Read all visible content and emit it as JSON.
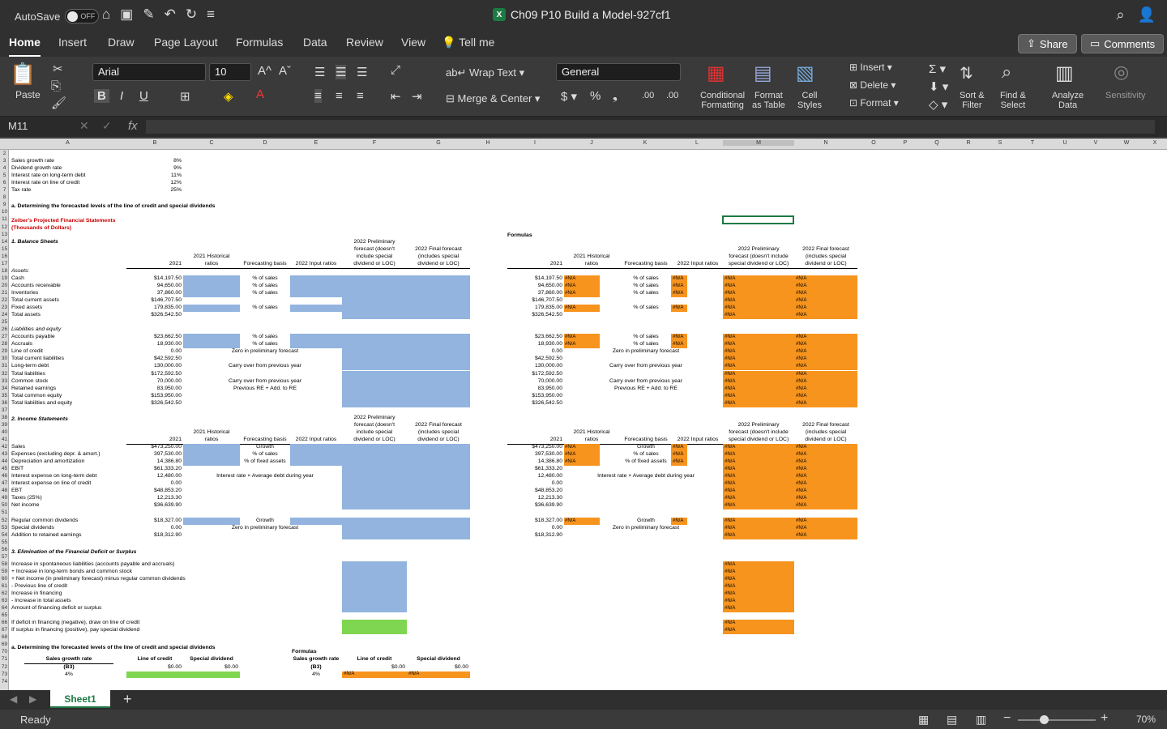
{
  "titlebar": {
    "autosave_label": "AutoSave",
    "toggle_state": "OFF",
    "doc_title": "Ch09 P10 Build a Model-927cf1"
  },
  "tabs": [
    "Home",
    "Insert",
    "Draw",
    "Page Layout",
    "Formulas",
    "Data",
    "Review",
    "View",
    "Tell me"
  ],
  "share": "Share",
  "comments": "Comments",
  "ribbon": {
    "paste": "Paste",
    "font": "Arial",
    "size": "10",
    "wrap": "Wrap Text",
    "merge": "Merge & Center",
    "numfmt": "General",
    "cond": [
      "Conditional",
      "Formatting"
    ],
    "fmttable": [
      "Format",
      "as Table"
    ],
    "cellstyles": [
      "Cell",
      "Styles"
    ],
    "insert": "Insert",
    "delete": "Delete",
    "format": "Format",
    "sort": [
      "Sort &",
      "Filter"
    ],
    "find": [
      "Find &",
      "Select"
    ],
    "analyze": [
      "Analyze",
      "Data"
    ],
    "sensitivity": "Sensitivity"
  },
  "formula": {
    "namebox": "M11",
    "fx": "fx"
  },
  "columns": [
    "A",
    "B",
    "C",
    "D",
    "E",
    "F",
    "G",
    "H",
    "I",
    "J",
    "K",
    "L",
    "M",
    "N",
    "O",
    "P",
    "Q",
    "R",
    "S",
    "T",
    "U",
    "V",
    "W",
    "X"
  ],
  "inputs": {
    "r3": [
      "Sales growth rate",
      "8%"
    ],
    "r4": [
      "Dividend growth rate",
      "9%"
    ],
    "r5": [
      "Interest rate on long-term debt",
      "11%"
    ],
    "r6": [
      "Interest rate on line of credit",
      "12%"
    ],
    "r7": [
      "Tax rate",
      "25%"
    ]
  },
  "section_a": "a.  Determining the forecasted levels of the line of credit and special dividends",
  "zeiber": [
    "Zeiber's Projected Financial Statements",
    "(Thousands of Dollars)"
  ],
  "formulas_label": "Formulas",
  "bs": {
    "title": "1. Balance Sheets",
    "h": {
      "yr": "2021",
      "hist": [
        "2021 Historical",
        "ratios"
      ],
      "basis": "Forecasting basis",
      "inp": "2022 Input ratios",
      "prelim": [
        "2022 Preliminary",
        "forecast (doesn't",
        "include special",
        "dividend or LOC)"
      ],
      "final": [
        "2022 Final forecast",
        "(includes special",
        "dividend or LOC)"
      ],
      "prelimM": [
        "2022 Preliminary",
        "forecast (doesn't include",
        "special dividend or LOC)"
      ],
      "finalN": [
        "2022 Final forecast",
        "(includes special",
        "dividend or LOC)"
      ]
    },
    "rows": [
      [
        "Assets:",
        "",
        ""
      ],
      [
        "Cash",
        "$14,197.50",
        "% of sales"
      ],
      [
        "Accounts receivable",
        "94,650.00",
        "% of sales"
      ],
      [
        "Inventories",
        "37,860.00",
        "% of sales"
      ],
      [
        "   Total current assets",
        "$146,707.50",
        ""
      ],
      [
        "Fixed assets",
        "179,835.00",
        "% of sales"
      ],
      [
        "Total assets",
        "$326,542.50",
        ""
      ]
    ],
    "rows2": [
      [
        "Liabilities and equity",
        "",
        ""
      ],
      [
        "Accounts payable",
        "$23,662.50",
        "% of sales"
      ],
      [
        "Accruals",
        "18,930.00",
        "% of sales"
      ],
      [
        "Line of credit",
        "0.00",
        "Zero in preliminary forecast"
      ],
      [
        "   Total current liabilities",
        "$42,592.50",
        ""
      ],
      [
        "Long-term debt",
        "130,000.00",
        "Carry over from previous year"
      ],
      [
        "   Total liabilities",
        "$172,592.50",
        ""
      ],
      [
        "Common stock",
        "70,000.00",
        "Carry over from previous year"
      ],
      [
        "Retained earnings",
        "83,950.00",
        "Previous RE + Add. to RE"
      ],
      [
        "   Total common equity",
        "$153,950.00",
        ""
      ],
      [
        "Total liabilities and equity",
        "$326,542.50",
        ""
      ]
    ]
  },
  "is": {
    "title": "2. Income Statements",
    "rows": [
      [
        "Sales",
        "$473,250.00",
        "Growth"
      ],
      [
        "Expenses (excluding depr. & amort.)",
        "397,530.00",
        "% of sales"
      ],
      [
        "Depreciation and amortization",
        "14,386.80",
        "% of fixed assets"
      ],
      [
        "   EBIT",
        "$61,333.20",
        ""
      ],
      [
        "Interest expense on long-term debt",
        "12,480.00",
        "Interest rate × Average debt during year"
      ],
      [
        "Interest expense on line of credit",
        "0.00",
        ""
      ],
      [
        "   EBT",
        "$48,853.20",
        ""
      ],
      [
        "Taxes (25%)",
        "12,213.30",
        ""
      ],
      [
        "   Net income",
        "$36,639.90",
        ""
      ]
    ],
    "div": [
      [
        "Regular common dividends",
        "$18,327.00",
        "Growth"
      ],
      [
        "Special dividends",
        "0.00",
        "Zero in preliminary forecast"
      ],
      [
        "Addition to retained earnings",
        "$18,312.90",
        ""
      ]
    ]
  },
  "elim": {
    "title": "3. Elimination of the Financial Deficit or Surplus",
    "rows": [
      "Increase in spontaneous liabilities (accounts payable and accruals)",
      "+ Increase in long-term bonds and common stock",
      "+ Net income (in preliminary forecast) minus regular common dividends",
      "- Previous line of credit",
      "Increase in financing",
      "- Increase in total assets",
      "Amount of financing deficit or surplus"
    ],
    "rows2": [
      "If deficit in financing (negative), draw on line of credit",
      "If surplus in financing (positive), pay special dividend"
    ]
  },
  "tbl": {
    "h": [
      "Sales growth rate",
      "(B3)",
      "Line of credit",
      "Special dividend"
    ],
    "v": [
      "4%",
      "$0.00",
      "$0.00"
    ],
    "formulas": "Formulas"
  },
  "na": "#N/A",
  "sheet": "Sheet1",
  "status": {
    "ready": "Ready",
    "zoom": "70%"
  }
}
